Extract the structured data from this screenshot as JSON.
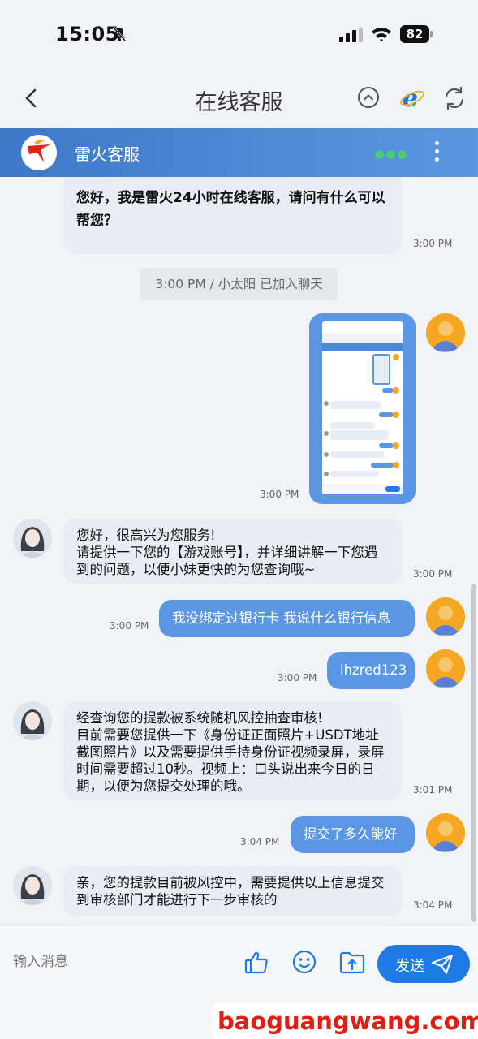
{
  "status_bar": {
    "time": "15:05",
    "battery": "82"
  },
  "nav": {
    "title": "在线客服"
  },
  "chat_header": {
    "name": "雷火客服"
  },
  "messages": {
    "m1": {
      "text": "您好，我是雷火24小时在线客服，请问有什么可以帮您？",
      "time": "3:00 PM"
    },
    "sys": {
      "text": "3:00 PM / 小太阳 已加入聊天"
    },
    "m2": {
      "time": "3:00 PM"
    },
    "m3": {
      "text": "您好，很高兴为您服务!\n请提供一下您的【游戏账号】，并详细讲解一下您遇到的问题，以便小妹更快的为您查询哦~",
      "time": "3:00 PM"
    },
    "m4": {
      "text": "我没绑定过银行卡 我说什么银行信息",
      "time": "3:00 PM"
    },
    "m5": {
      "text": "lhzred123",
      "time": "3:00 PM"
    },
    "m6": {
      "text": "经查询您的提款被系统随机风控抽查审核!\n目前需要您提供一下《身份证正面照片+USDT地址截图照片》以及需要提供手持身份证视频录屏，录屏时间需要超过10秒。视频上：口头说出来今日的日期，以便为您提交处理的哦。",
      "time": "3:01 PM"
    },
    "m7": {
      "text": "提交了多久能好",
      "time": "3:04 PM"
    },
    "m8": {
      "text": "亲，您的提款目前被风控中，需要提供以上信息提交到审核部门才能进行下一步审核的",
      "time": "3:04 PM"
    }
  },
  "input": {
    "placeholder": "输入消息",
    "send_label": "发送"
  },
  "watermark": "baoguangwang.com",
  "colors": {
    "accent": "#1f7ae6",
    "bubble_out": "#5a96e3",
    "bubble_in": "#e8ecf4",
    "header_start": "#3e78c7",
    "online": "#4cc97b"
  }
}
